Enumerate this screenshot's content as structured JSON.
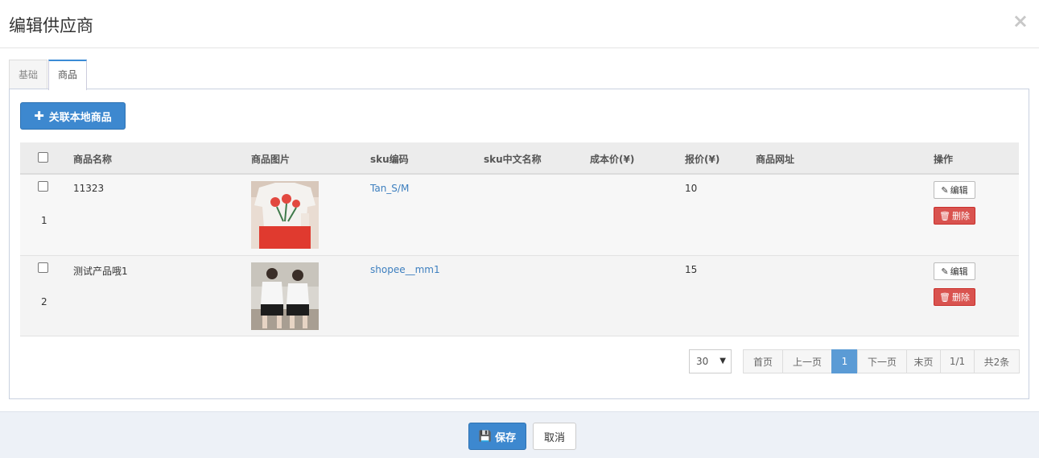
{
  "dialog": {
    "title": "编辑供应商",
    "close_glyph": "×"
  },
  "tabs": [
    {
      "label": "基础"
    },
    {
      "label": "商品"
    }
  ],
  "add_button": {
    "label": "关联本地商品",
    "icon": "plus-icon"
  },
  "table": {
    "headers": [
      "商品名称",
      "商品图片",
      "sku编码",
      "sku中文名称",
      "成本价(¥)",
      "报价(¥)",
      "商品网址",
      "操作"
    ],
    "rows": [
      {
        "index": "1",
        "name": "11323",
        "sku": "Tan_S/M",
        "sku_cn": "",
        "cost": "",
        "price": "10",
        "url": "",
        "image": "product-photo-tshirt-tulip"
      },
      {
        "index": "2",
        "name": "测试产品哦1",
        "sku": "shopee__mm1",
        "sku_cn": "",
        "cost": "",
        "price": "15",
        "url": "",
        "image": "product-photo-couple-tshirts"
      }
    ],
    "edit_label": "编辑",
    "delete_label": "删除"
  },
  "pagination": {
    "page_size": "30",
    "first": "首页",
    "prev": "上一页",
    "current": "1",
    "next": "下一页",
    "last": "末页",
    "page_of": "1/1",
    "total": "共2条"
  },
  "footer": {
    "save_label": "保存",
    "cancel_label": "取消"
  },
  "colors": {
    "primary": "#3d88cf",
    "danger": "#d9534f",
    "link": "#3d7fbf",
    "active_page": "#5b9bd5"
  }
}
